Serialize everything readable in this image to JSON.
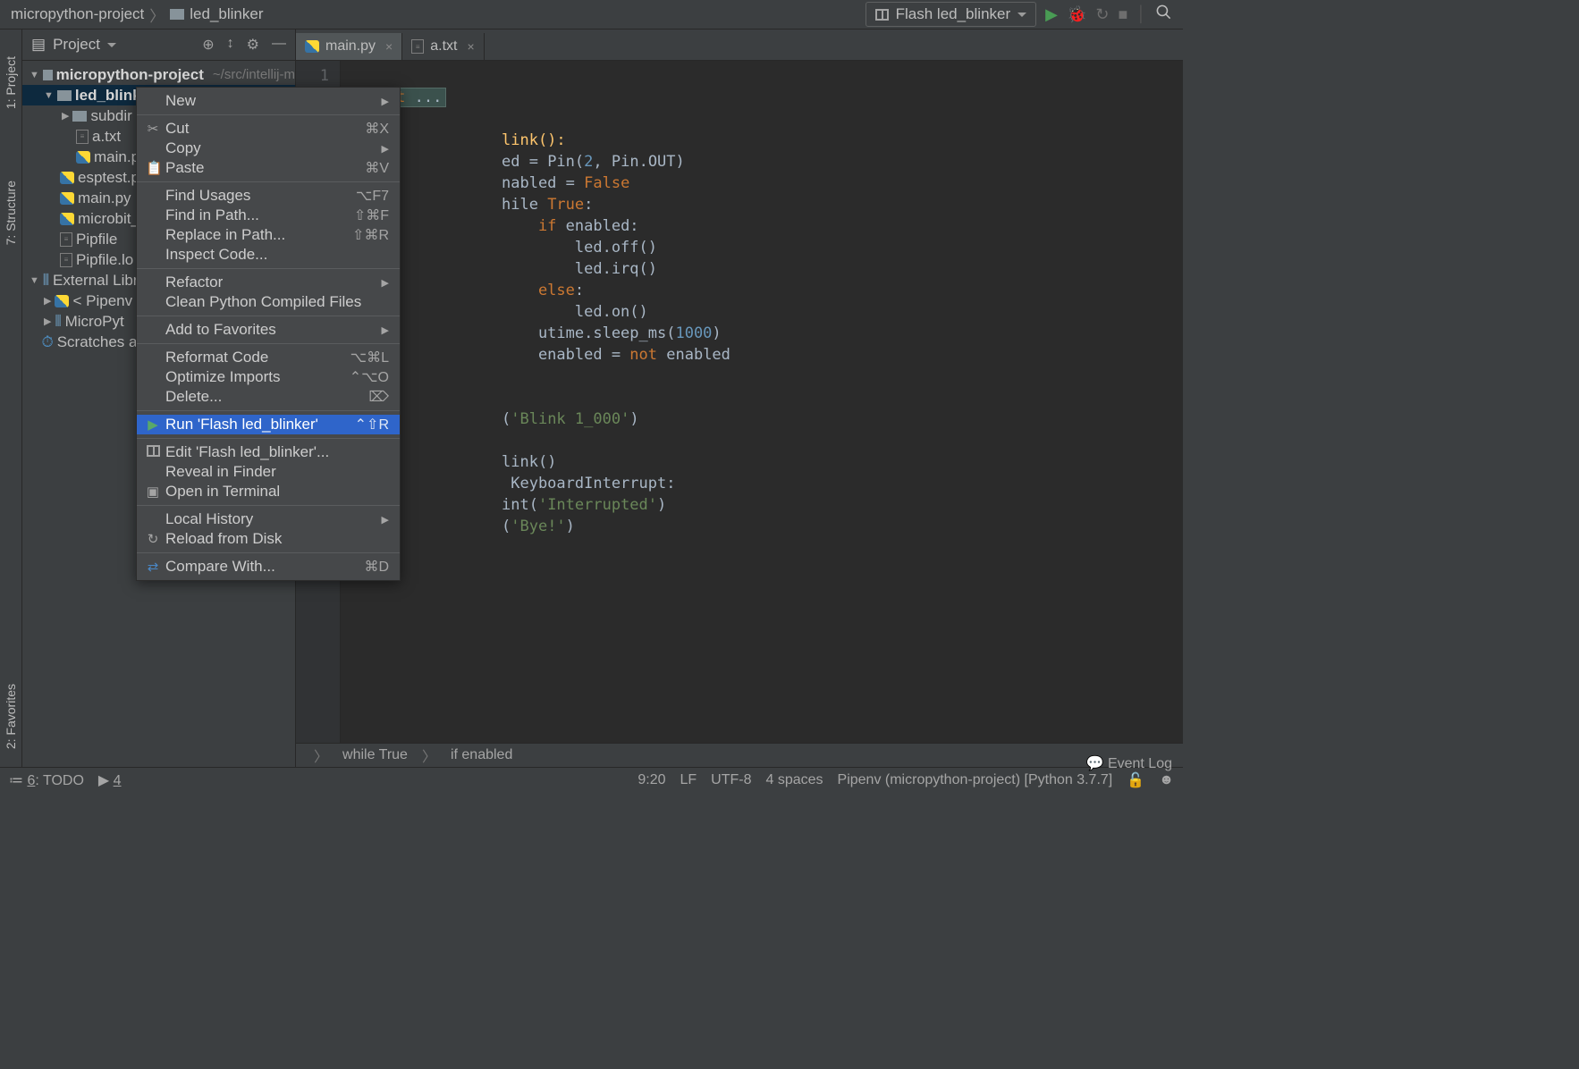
{
  "breadcrumb": {
    "root": "micropython-project",
    "current": "led_blinker"
  },
  "run_config": "Flash led_blinker",
  "left_rail": {
    "project": "1: Project",
    "structure": "7: Structure",
    "favorites": "2: Favorites"
  },
  "project_header": "Project",
  "tree": {
    "root": "micropython-project",
    "root_path": "~/src/intellij-m",
    "led_blinker": "led_blinker",
    "subdir": "subdir",
    "atxt": "a.txt",
    "mainp": "main.p",
    "esptest": "esptest.p",
    "mainpy": "main.py",
    "microbit": "microbit_",
    "pipfile": "Pipfile",
    "pipfilelock": "Pipfile.lo",
    "external": "External Libr",
    "pipenv": "< Pipenv",
    "mpy": "MicroPyt",
    "scratches": "Scratches a"
  },
  "tabs": {
    "main": "main.py",
    "atxt": "a.txt"
  },
  "editor": {
    "line1_num": "1",
    "line1": "import ...",
    "t_link": "link():",
    "t_ed": "ed = ",
    "t_pin": "Pin",
    "t_pin2": "(",
    "t_two": "2",
    "t_comma": ", Pin.OUT)",
    "t_nabled": "nabled = ",
    "t_false": "False",
    "t_hile": "hile ",
    "t_true": "True",
    "t_colon": ":",
    "t_if": "if",
    "t_enabled": " enabled:",
    "t_ledoff": "led.off()",
    "t_ledirq": "led.irq()",
    "t_else": "else",
    "t_colon2": ":",
    "t_ledon": "led.on()",
    "t_sleep1": "utime.sleep_ms(",
    "t_1000": "1000",
    "t_sleep2": ")",
    "t_en2": "enabled = ",
    "t_not": "not",
    "t_en3": " enabled",
    "t_blink": "'Blink 1_000'",
    "t_paren_o": "(",
    "t_paren_c": ")",
    "t_link2": "link()",
    "t_kbi": " KeyboardInterrupt:",
    "t_int1": "int(",
    "t_intstr": "'Interrupted'",
    "t_int2": ")",
    "t_bye1": "(",
    "t_byestr": "'Bye!'",
    "t_bye2": ")"
  },
  "crumb_while": "while True",
  "crumb_if": "if enabled",
  "ctx": {
    "new": "New",
    "cut": "Cut",
    "cut_sc": "⌘X",
    "copy": "Copy",
    "paste": "Paste",
    "paste_sc": "⌘V",
    "find_usages": "Find Usages",
    "fu_sc": "⌥F7",
    "find_path": "Find in Path...",
    "fp_sc": "⇧⌘F",
    "replace_path": "Replace in Path...",
    "rp_sc": "⇧⌘R",
    "inspect": "Inspect Code...",
    "refactor": "Refactor",
    "clean": "Clean Python Compiled Files",
    "favorites": "Add to Favorites",
    "reformat": "Reformat Code",
    "rc_sc": "⌥⌘L",
    "optimize": "Optimize Imports",
    "oi_sc": "⌃⌥O",
    "delete": "Delete...",
    "del_sc": "⌦",
    "run": "Run 'Flash led_blinker'",
    "run_sc": "⌃⇧R",
    "edit": "Edit 'Flash led_blinker'...",
    "reveal": "Reveal in Finder",
    "open_term": "Open in Terminal",
    "local_hist": "Local History",
    "reload": "Reload from Disk",
    "compare": "Compare With...",
    "cmp_sc": "⌘D"
  },
  "bottom": {
    "todo": "6: TODO",
    "four": "4",
    "eventlog": "Event Log"
  },
  "status": {
    "pos": "9:20",
    "le": "LF",
    "enc": "UTF-8",
    "indent": "4 spaces",
    "interp": "Pipenv (micropython-project) [Python 3.7.7]"
  }
}
